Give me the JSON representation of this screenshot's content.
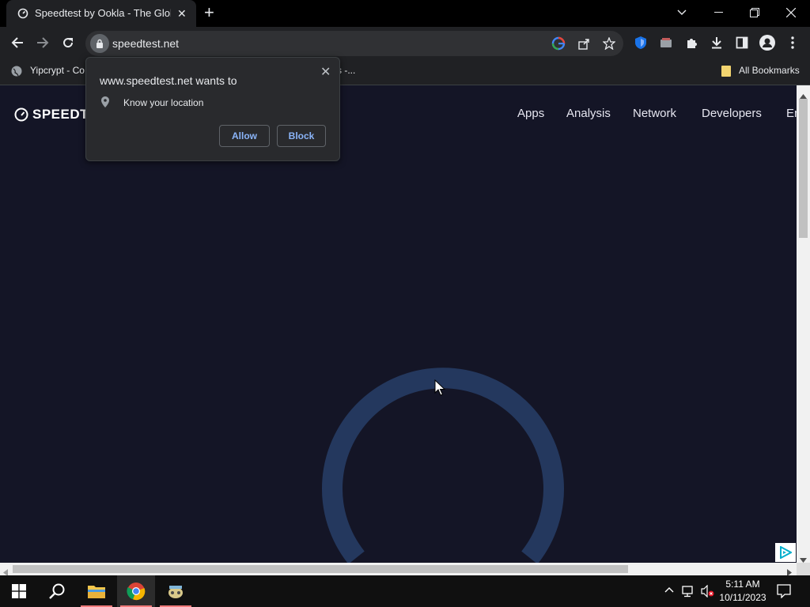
{
  "browser": {
    "tab_title": "Speedtest by Ookla - The Global",
    "url": "speedtest.net",
    "bookmarks": {
      "item1": "Yipcrypt - Co",
      "item2": "s -...",
      "all_bookmarks": "All Bookmarks"
    }
  },
  "permission_popup": {
    "title": "www.speedtest.net wants to",
    "permission": "Know your location",
    "allow_label": "Allow",
    "block_label": "Block"
  },
  "page": {
    "logo_text": "SPEEDT",
    "nav": [
      "Apps",
      "Analysis",
      "Network",
      "Developers",
      "En"
    ]
  },
  "taskbar": {
    "time": "5:11 AM",
    "date": "10/11/2023"
  },
  "colors": {
    "page_bg": "#141526",
    "gauge": "#24385e",
    "accent_link": "#8ab4f8"
  }
}
